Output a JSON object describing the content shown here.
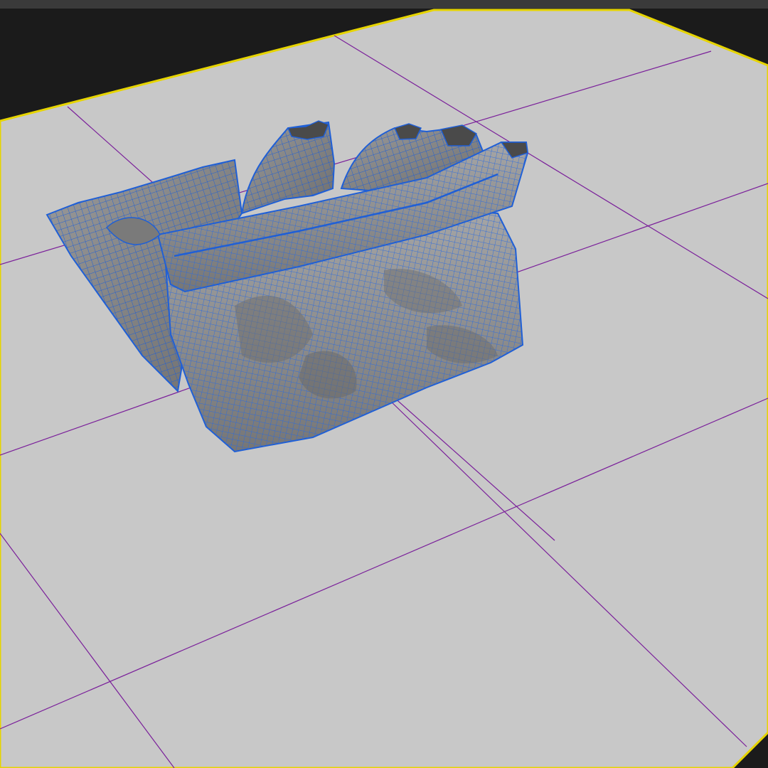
{
  "viewport": {
    "background_color": "#1b1b1b",
    "ground_color": "#c8c8c8",
    "ground_edge_color": "#e6d400",
    "grid_color": "#7a1f9a",
    "mesh_surface_color": "#8a8a8a",
    "mesh_shadow_color": "#6a6a6a",
    "mesh_wire_color": "#1f5fd6",
    "selected_object": "cloth-bag-mesh"
  },
  "icons": {
    "mesh": "cloth-mesh-icon",
    "grid": "ground-grid-icon"
  }
}
